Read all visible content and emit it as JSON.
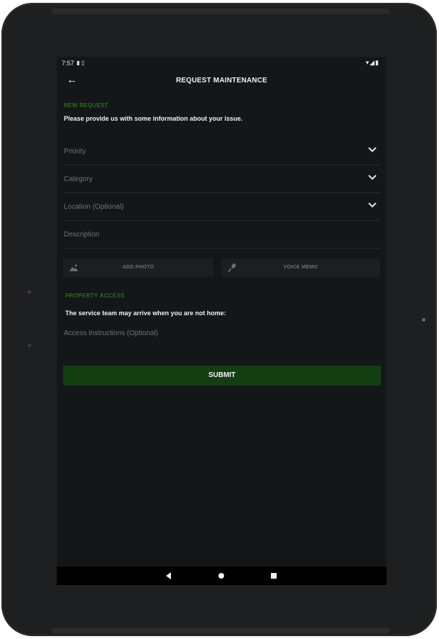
{
  "status_bar": {
    "time": "7:57",
    "notification_icons": "▮ ▯",
    "system_icons": "▾◢▮"
  },
  "app_bar": {
    "title": "REQUEST MAINTENANCE"
  },
  "request": {
    "section_label": "NEW REQUEST",
    "intro": "Please provide us with some information about your issue.",
    "fields": [
      {
        "label": "Priority"
      },
      {
        "label": "Category"
      },
      {
        "label": "Location (Optional)"
      }
    ],
    "description_label": "Description",
    "add_photo_label": "ADD PHOTO",
    "voice_memo_label": "VOICE MEMO"
  },
  "access": {
    "section_label": "PROPERTY ACCESS",
    "notice": "The service team may arrive when you are not home:",
    "instructions_label": "Access Instructions (Optional)"
  },
  "submit_label": "SUBMIT",
  "colors": {
    "accent_green": "#2b6e1e",
    "submit_bg": "#133e12",
    "screen_bg": "#141719"
  }
}
